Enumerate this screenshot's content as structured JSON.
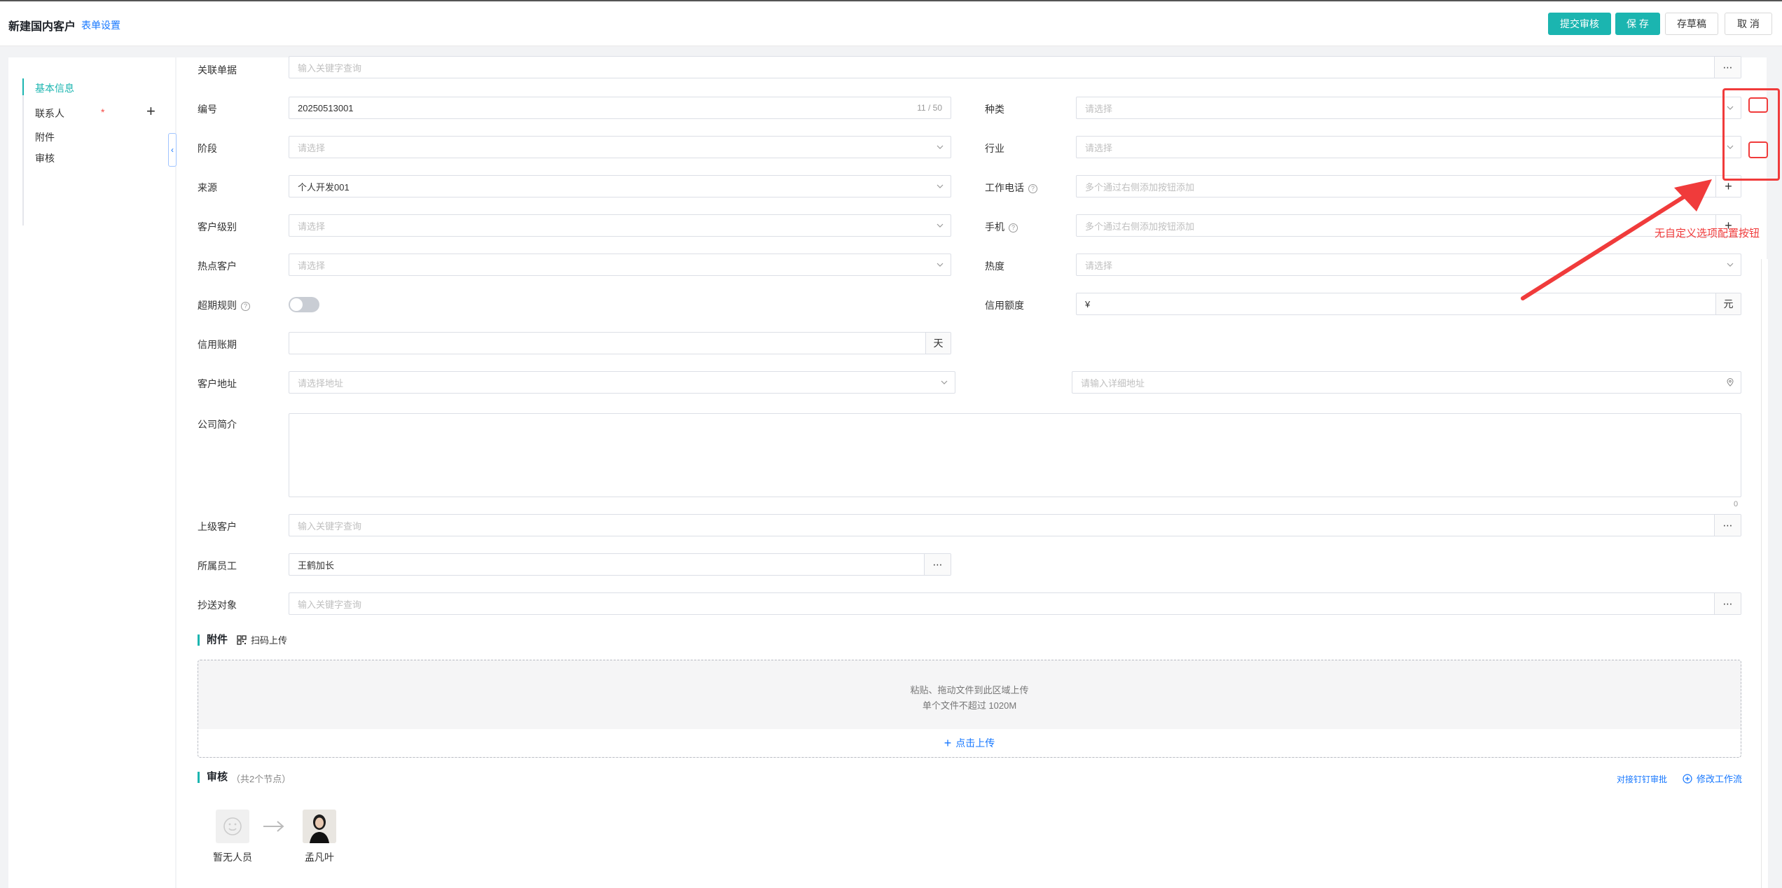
{
  "header": {
    "title": "新建国内客户",
    "form_settings": "表单设置",
    "submit_review": "提交审核",
    "save": "保 存",
    "save_draft": "存草稿",
    "cancel": "取 消"
  },
  "sidebar": {
    "items": [
      {
        "label": "基本信息"
      },
      {
        "label": "联系人"
      },
      {
        "label": "附件"
      },
      {
        "label": "审核"
      }
    ],
    "required_mark": "*",
    "add": "+",
    "collapse": "‹"
  },
  "form": {
    "related_doc": {
      "label": "关联单据",
      "placeholder": "输入关键字查询"
    },
    "number": {
      "label": "编号",
      "value": "20250513001",
      "count": "11 / 50"
    },
    "category": {
      "label": "种类",
      "placeholder": "请选择"
    },
    "stage": {
      "label": "阶段",
      "placeholder": "请选择"
    },
    "industry": {
      "label": "行业",
      "placeholder": "请选择"
    },
    "source": {
      "label": "来源",
      "value": "个人开发001"
    },
    "work_phone": {
      "label": "工作电话",
      "placeholder": "多个通过右侧添加按钮添加",
      "help": "?",
      "add": "+"
    },
    "customer_level": {
      "label": "客户级别",
      "placeholder": "请选择"
    },
    "mobile": {
      "label": "手机",
      "placeholder": "多个通过右侧添加按钮添加",
      "help": "?",
      "add": "+"
    },
    "hot_customer": {
      "label": "热点客户",
      "placeholder": "请选择"
    },
    "heat": {
      "label": "热度",
      "placeholder": "请选择"
    },
    "overdue_rule": {
      "label": "超期规则",
      "help": "?",
      "enabled": false
    },
    "credit_limit": {
      "label": "信用额度",
      "prefix": "¥",
      "suffix": "元"
    },
    "credit_period": {
      "label": "信用账期",
      "suffix": "天"
    },
    "address": {
      "label": "客户地址",
      "placeholder": "请选择地址",
      "detail_placeholder": "请输入详细地址"
    },
    "company_intro": {
      "label": "公司简介",
      "count": "0"
    },
    "parent_customer": {
      "label": "上级客户",
      "placeholder": "输入关键字查询"
    },
    "staff": {
      "label": "所属员工",
      "value": "王鹤加长"
    },
    "cc": {
      "label": "抄送对象",
      "placeholder": "输入关键字查询"
    },
    "more": "⋯"
  },
  "attachment": {
    "title": "附件",
    "scan_upload": "扫码上传",
    "drop_hint": "粘贴、拖动文件到此区域上传",
    "size_hint": "单个文件不超过 1020M",
    "click_upload": "点击上传"
  },
  "review": {
    "title": "审核",
    "node_count": "（共2个节点）",
    "dingtalk": "对接钉钉审批",
    "edit_workflow": "修改工作流",
    "nodes": [
      {
        "name": "暂无人员"
      },
      {
        "name": "孟凡叶"
      }
    ]
  },
  "annotation": {
    "text": "无自定义选项配置按钮",
    "color": "#f03b3b"
  },
  "colors": {
    "accent": "#1bb5b0",
    "link": "#1677ff"
  }
}
